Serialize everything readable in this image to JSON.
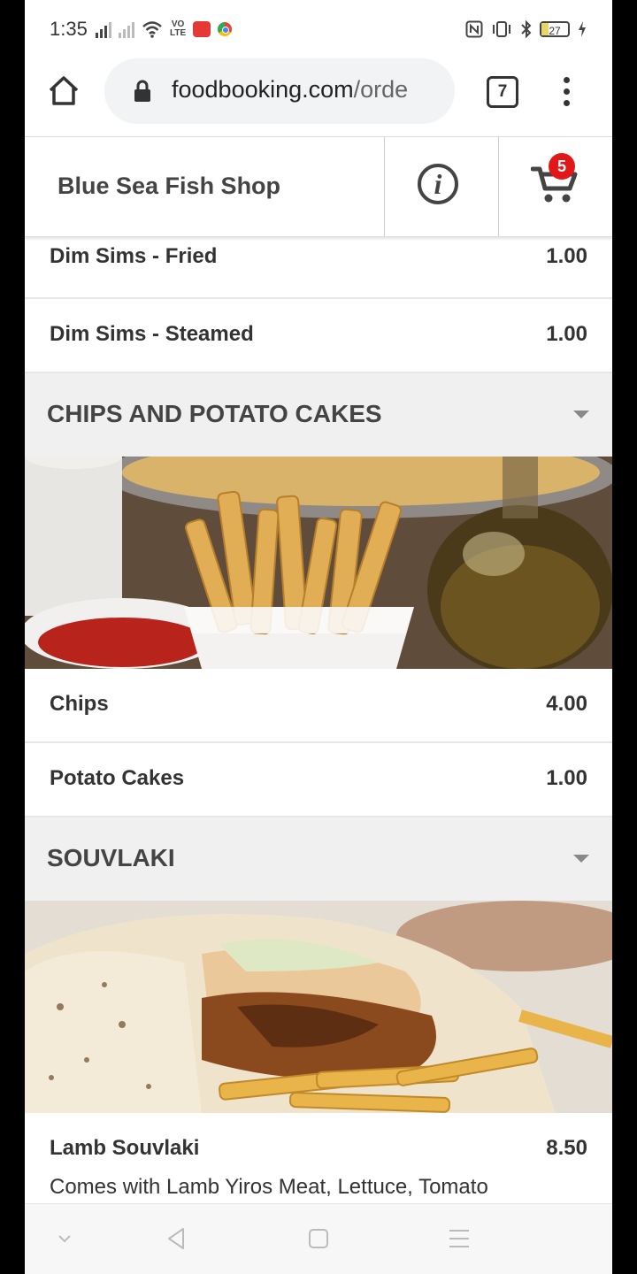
{
  "status_bar": {
    "time": "1:35",
    "volte_label": "VO\nLTE",
    "battery": "27"
  },
  "browser": {
    "url_main": "foodbooking.com",
    "url_rest": "/orde",
    "tab_count": "7"
  },
  "header": {
    "shop_name": "Blue Sea Fish Shop",
    "cart_count": "5"
  },
  "menu": {
    "top_items": [
      {
        "name": "Dim Sims - Fried",
        "price": "1.00"
      },
      {
        "name": "Dim Sims - Steamed",
        "price": "1.00"
      }
    ],
    "sections": [
      {
        "title": "CHIPS AND POTATO CAKES",
        "items": [
          {
            "name": "Chips",
            "price": "4.00"
          },
          {
            "name": "Potato Cakes",
            "price": "1.00"
          }
        ]
      },
      {
        "title": "SOUVLAKI",
        "items": [
          {
            "name": "Lamb Souvlaki",
            "price": "8.50",
            "description": "Comes with Lamb Yiros Meat, Lettuce, Tomato"
          }
        ]
      }
    ]
  },
  "colors": {
    "badge": "#e21818",
    "section_bg": "#f0f0f0",
    "text": "#333333"
  }
}
